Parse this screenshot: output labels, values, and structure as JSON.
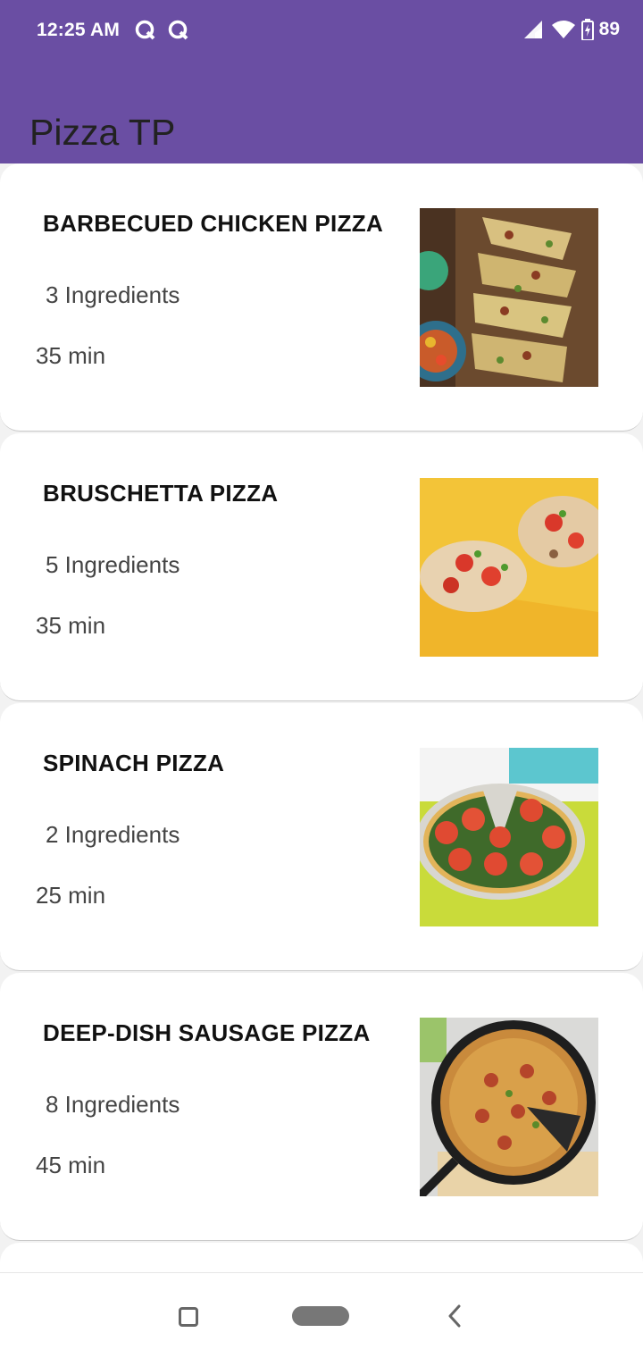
{
  "status_bar": {
    "time": "12:25 AM",
    "notification_icons": [
      "q-notification-icon",
      "q-notification-icon"
    ],
    "battery": "89",
    "icons": [
      "signal-icon",
      "wifi-icon",
      "battery-charging-icon"
    ]
  },
  "app_bar": {
    "title": "Pizza TP"
  },
  "recipes": [
    {
      "title": "BARBECUED CHICKEN PIZZA",
      "ingredients": "3 Ingredients",
      "time": "35 min"
    },
    {
      "title": "BRUSCHETTA PIZZA",
      "ingredients": "5 Ingredients",
      "time": "35 min"
    },
    {
      "title": "SPINACH PIZZA",
      "ingredients": "2 Ingredients",
      "time": "25 min"
    },
    {
      "title": "DEEP-DISH SAUSAGE PIZZA",
      "ingredients": "8 Ingredients",
      "time": "45 min"
    }
  ],
  "nav_bar": {
    "icons": [
      "recents-icon",
      "home-icon",
      "back-icon"
    ]
  },
  "colors": {
    "primary": "#6a4ea3",
    "card": "#ffffff",
    "background": "#f2f2f2"
  }
}
